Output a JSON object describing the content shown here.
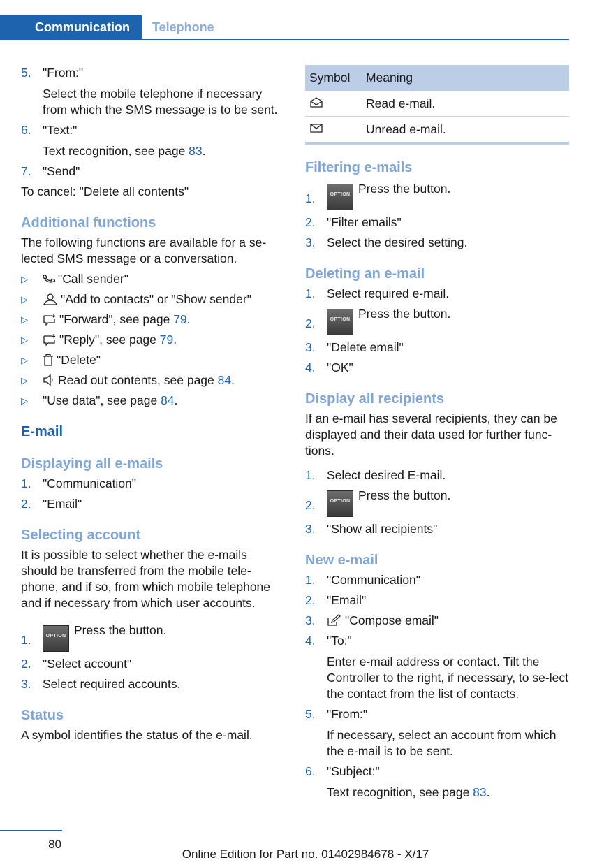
{
  "header": {
    "tab_active": "Communication",
    "tab_inactive": "Telephone"
  },
  "left": {
    "step5_num": "5.",
    "step5_label": "\"From:\"",
    "step5_text": "Select the mobile telephone if necessary from which the SMS message is to be sent.",
    "step6_num": "6.",
    "step6_label": "\"Text:\"",
    "step6_text": "Text recognition, see page ",
    "step6_page": "83",
    "step7_num": "7.",
    "step7_label": "\"Send\"",
    "cancel": "To cancel: \"Delete all contents\"",
    "additional_heading": "Additional functions",
    "additional_text": "The following functions are available for a se‐lected SMS message or a conversation.",
    "bullet_marker": "▷",
    "bullets": {
      "call": "\"Call sender\"",
      "contacts": "\"Add to contacts\" or \"Show sender\"",
      "forward": "\"Forward\", see page ",
      "forward_page": "79",
      "reply": "\"Reply\", see page ",
      "reply_page": "79",
      "delete": "\"Delete\"",
      "readout": "Read out contents, see page ",
      "readout_page": "84",
      "usedata": "\"Use data\", see page ",
      "usedata_page": "84"
    },
    "email_heading": "E-mail",
    "displaying_heading": "Displaying all e-mails",
    "disp1_num": "1.",
    "disp1": "\"Communication\"",
    "disp2_num": "2.",
    "disp2": "\"Email\"",
    "selecting_heading": "Selecting account",
    "selecting_text": "It is possible to select whether the e-mails should be transferred from the mobile tele‐phone, and if so, from which mobile telephone and if necessary from which user accounts.",
    "sel1_num": "1.",
    "sel1": "Press the button.",
    "sel2_num": "2.",
    "sel2": "\"Select account\"",
    "sel3_num": "3.",
    "sel3": "Select required accounts.",
    "status_heading": "Status",
    "status_text": "A symbol identifies the status of the e-mail."
  },
  "option_button_label": "OPTION",
  "right": {
    "table": {
      "col_symbol": "Symbol",
      "col_meaning": "Meaning",
      "rows": [
        {
          "icon": "envelope-open-icon",
          "meaning": "Read e-mail."
        },
        {
          "icon": "envelope-closed-icon",
          "meaning": "Unread e-mail."
        }
      ]
    },
    "filtering_heading": "Filtering e-mails",
    "f1_num": "1.",
    "f1": "Press the button.",
    "f2_num": "2.",
    "f2": "\"Filter emails\"",
    "f3_num": "3.",
    "f3": "Select the desired setting.",
    "deleting_heading": "Deleting an e-mail",
    "d1_num": "1.",
    "d1": "Select required e-mail.",
    "d2_num": "2.",
    "d2": "Press the button.",
    "d3_num": "3.",
    "d3": "\"Delete email\"",
    "d4_num": "4.",
    "d4": "\"OK\"",
    "recipients_heading": "Display all recipients",
    "recipients_text": "If an e-mail has several recipients, they can be displayed and their data used for further func‐tions.",
    "r1_num": "1.",
    "r1": "Select desired E-mail.",
    "r2_num": "2.",
    "r2": "Press the button.",
    "r3_num": "3.",
    "r3": "\"Show all recipients\"",
    "new_heading": "New e-mail",
    "n1_num": "1.",
    "n1": "\"Communication\"",
    "n2_num": "2.",
    "n2": "\"Email\"",
    "n3_num": "3.",
    "n3": "\"Compose email\"",
    "n4_num": "4.",
    "n4": "\"To:\"",
    "n4_text": "Enter e-mail address or contact. Tilt the Controller to the right, if necessary, to se‐lect the contact from the list of contacts.",
    "n5_num": "5.",
    "n5": "\"From:\"",
    "n5_text": "If necessary, select an account from which the e-mail is to be sent.",
    "n6_num": "6.",
    "n6": "\"Subject:\"",
    "n6_text": "Text recognition, see page ",
    "n6_page": "83"
  },
  "footer": {
    "page_number": "80",
    "edition": "Online Edition for Part no. 01402984678 - X/17"
  }
}
